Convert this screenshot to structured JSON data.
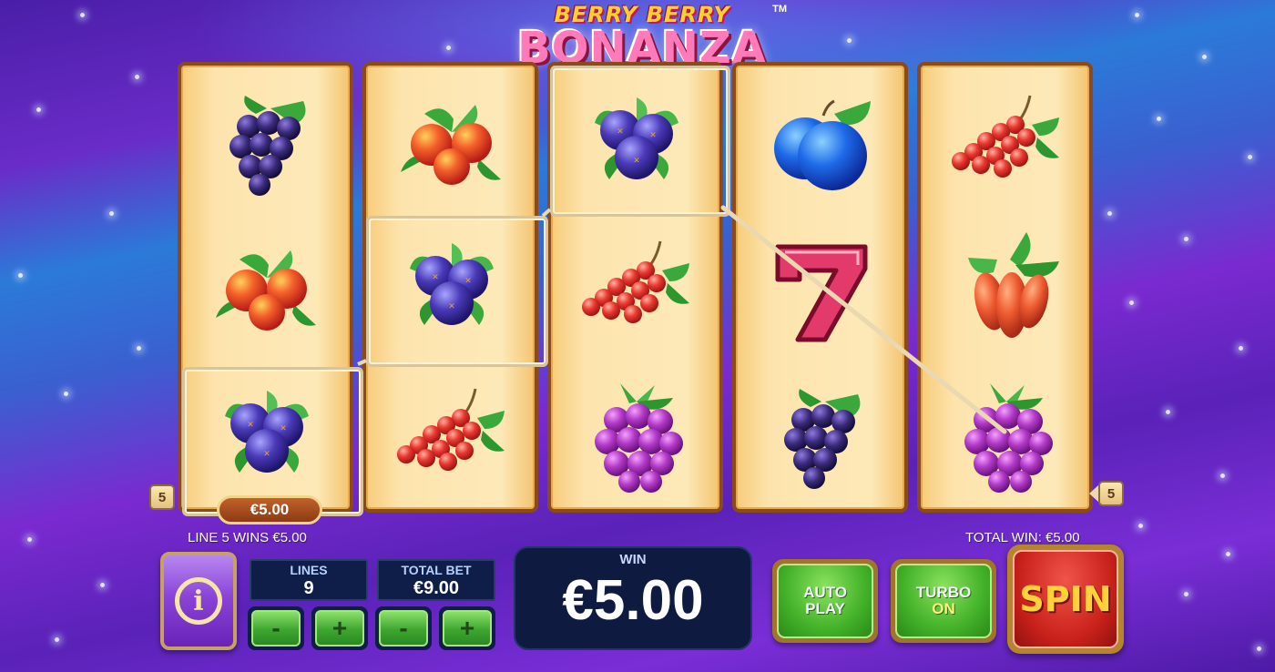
{
  "game": {
    "logo_top": "BERRY BERRY",
    "logo_main": "BONANZA",
    "trademark": "TM"
  },
  "reels": [
    [
      "blackberry",
      "cranberry",
      "blueberry"
    ],
    [
      "cranberry",
      "blueberry",
      "redcurrant"
    ],
    [
      "blueberry",
      "redcurrant",
      "raspberry"
    ],
    [
      "plum",
      "seven",
      "blackberry"
    ],
    [
      "redcurrant",
      "goji",
      "raspberry"
    ]
  ],
  "payline": {
    "left_marker": "5",
    "right_marker": "5",
    "win_badge": "€5.00"
  },
  "status": {
    "line_win_text": "LINE 5 WINS €5.00",
    "total_win_text": "TOTAL WIN: €5.00"
  },
  "controls": {
    "info_icon": "info-icon",
    "lines_label": "LINES",
    "lines_value": "9",
    "total_bet_label": "TOTAL BET",
    "total_bet_value": "€9.00",
    "minus_label": "-",
    "plus_label": "+",
    "win_label": "WIN",
    "win_value": "€5.00",
    "autoplay_line1": "AUTO",
    "autoplay_line2": "PLAY",
    "turbo_line1": "TURBO",
    "turbo_line2": "ON",
    "spin_label": "SPIN"
  },
  "colors": {
    "reel_bg": "#fde4ad",
    "reel_border": "#8a4a1c",
    "button_green": "#44b22a",
    "spin_red": "#c8201a",
    "info_purple": "#8a44d8",
    "display_navy": "#0e1e48"
  }
}
